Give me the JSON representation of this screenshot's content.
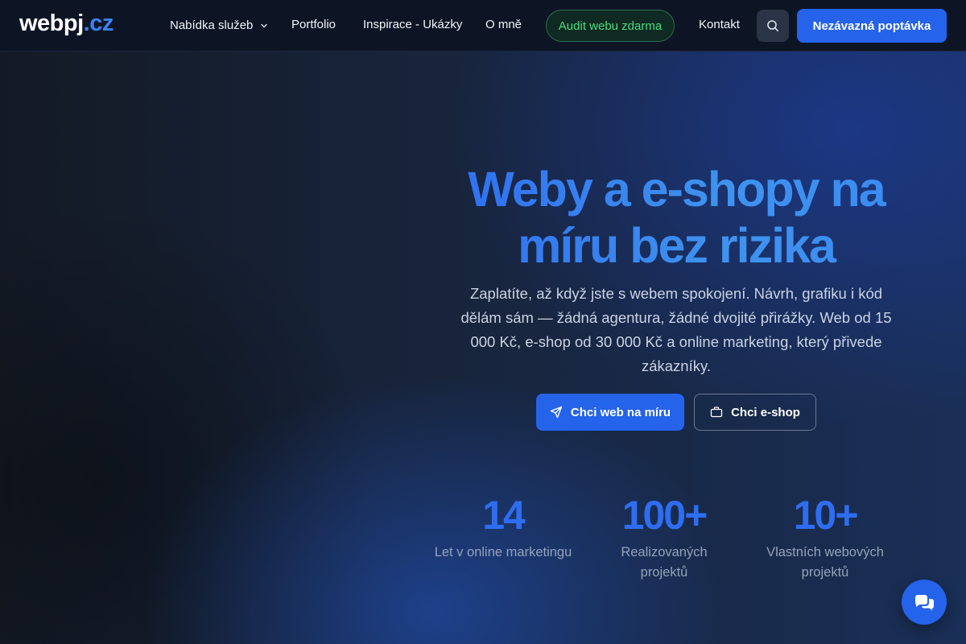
{
  "header": {
    "logo_main": "webpj",
    "logo_accent": ".cz",
    "nav": {
      "services": "Nabídka služeb",
      "portfolio": "Portfolio",
      "inspiration": "Inspirace - Ukázky",
      "about": "O mně",
      "audit": "Audit webu zdarma",
      "contact": "Kontakt"
    },
    "cta": "Nezávazná poptávka"
  },
  "hero": {
    "title_line1": "Weby a e-shopy na",
    "title_line2": "míru bez rizika",
    "subtitle": "Zaplatíte, až když jste s webem spokojení. Návrh, grafiku i kód dělám sám — žádná agentura, žádné dvojité přirážky. Web od 15 000 Kč, e-shop od 30 000 Kč a online marketing, který přivede zákazníky.",
    "primary_button": "Chci web na míru",
    "secondary_button": "Chci e-shop"
  },
  "stats": [
    {
      "value": "14",
      "label": "Let v online marketingu"
    },
    {
      "value": "100+",
      "label": "Realizovaných projektů"
    },
    {
      "value": "10+",
      "label": "Vlastních webových projektů"
    }
  ],
  "colors": {
    "accent": "#2563eb",
    "audit_green": "#4ade80",
    "header_bg": "#0d1525"
  },
  "icons": {
    "services_chevron": "chevron-down-icon",
    "search": "search-icon",
    "primary_button": "send-icon",
    "secondary_button": "briefcase-icon",
    "chat": "chat-icon"
  }
}
